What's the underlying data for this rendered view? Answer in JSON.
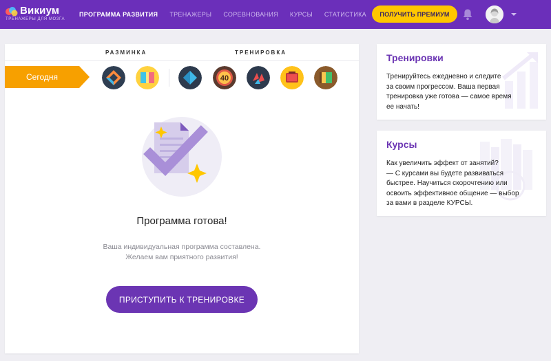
{
  "header": {
    "logo_name": "Викиум",
    "logo_tagline": "ТРЕНАЖЕРЫ ДЛЯ МОЗГА",
    "nav": [
      {
        "label": "ПРОГРАММА РАЗВИТИЯ",
        "active": true
      },
      {
        "label": "ТРЕНАЖЕРЫ",
        "active": false
      },
      {
        "label": "СОРЕВНОВАНИЯ",
        "active": false
      },
      {
        "label": "КУРСЫ",
        "active": false
      },
      {
        "label": "СТАТИСТИКА",
        "active": false
      }
    ],
    "premium_label": "ПОЛУЧИТЬ ПРЕМИУМ",
    "icons": [
      "bell-icon",
      "avatar",
      "chevron-down-icon"
    ]
  },
  "program": {
    "warmup_label": "РАЗМИНКА",
    "training_label": "ТРЕНИРОВКА",
    "today_label": "Сегодня",
    "badge_number": "40",
    "ready_title": "Программа готова!",
    "ready_line1": "Ваша индивидуальная программа составлена.",
    "ready_line2": "Желаем вам приятного развития!",
    "start_label": "ПРИСТУПИТЬ К ТРЕНИРОВКЕ"
  },
  "trainings_card": {
    "title": "Тренировки",
    "lines": [
      "Тренируйтесь ежедневно и следите",
      "за своим прогрессом. Ваша первая",
      "тренировка уже готова — самое время",
      "ее начать!"
    ]
  },
  "courses_card": {
    "title": "Курсы",
    "lines": [
      "Как увеличить эффект от занятий?",
      "— С курсами вы будете развиваться",
      "быстрее. Научиться скорочтению или",
      "освоить эффективное общение — выбор",
      "за вами в разделе КУРСЫ."
    ]
  },
  "colors": {
    "header_bg": "#6b2fba",
    "accent_purple": "#6b35b3",
    "premium_yellow": "#ffc700",
    "today_orange": "#f7a000"
  }
}
